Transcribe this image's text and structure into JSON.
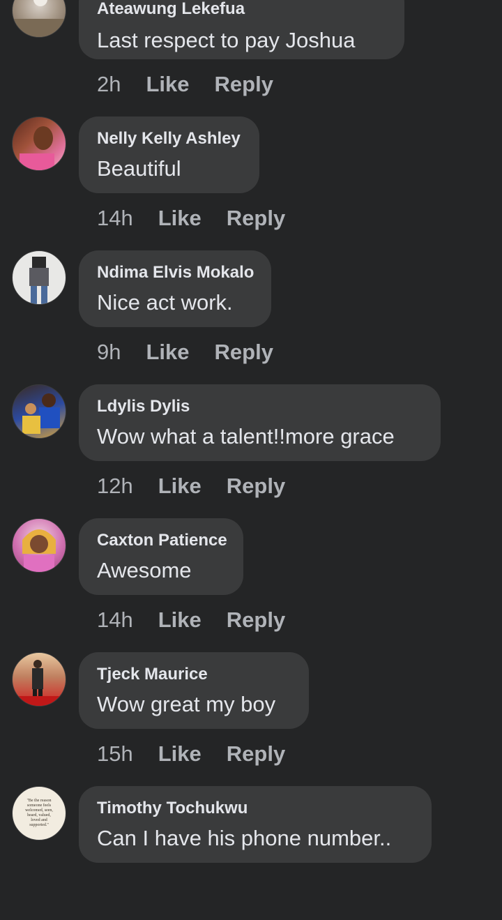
{
  "comments": [
    {
      "author": "Ateawung Lekefua",
      "text": "Last  respect to pay Joshua",
      "time": "2h",
      "like": "Like",
      "reply": "Reply"
    },
    {
      "author": "Nelly Kelly Ashley",
      "text": "Beautiful",
      "time": "14h",
      "like": "Like",
      "reply": "Reply"
    },
    {
      "author": "Ndima Elvis Mokalo",
      "text": "Nice act work.",
      "time": "9h",
      "like": "Like",
      "reply": "Reply"
    },
    {
      "author": "Ldylis Dylis",
      "text": "Wow what a talent!!more grace",
      "time": "12h",
      "like": "Like",
      "reply": "Reply"
    },
    {
      "author": "Caxton Patience",
      "text": "Awesome",
      "time": "14h",
      "like": "Like",
      "reply": "Reply"
    },
    {
      "author": "Tjeck Maurice",
      "text": "Wow great my boy",
      "time": "15h",
      "like": "Like",
      "reply": "Reply"
    },
    {
      "author": "Timothy Tochukwu",
      "text": "Can I have his phone number..",
      "time": "",
      "like": "",
      "reply": ""
    }
  ],
  "avatar_quote": "\"Be the reason someone feels welcomed, seen, heard, valued, loved and supported.\"",
  "colors": {
    "background": "#242526",
    "bubble": "#3a3b3c",
    "text": "#e4e6eb",
    "meta": "#b0b3b8"
  }
}
